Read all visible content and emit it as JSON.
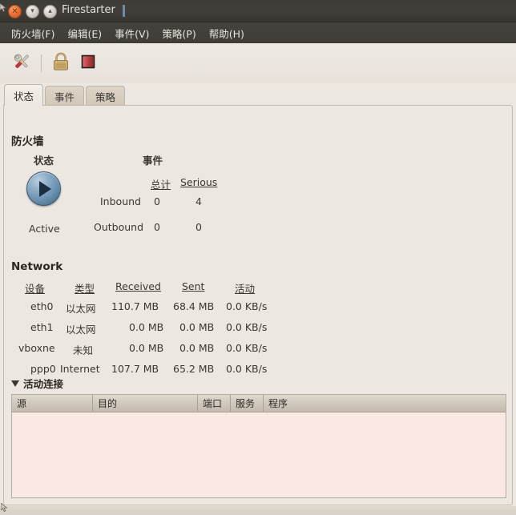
{
  "window": {
    "title": "Firestarter",
    "controls": [
      {
        "name": "close",
        "icon": "close-icon",
        "glyph": "✕"
      },
      {
        "name": "minimize",
        "icon": "minimize-icon",
        "glyph": "▾"
      },
      {
        "name": "maximize",
        "icon": "maximize-icon",
        "glyph": "▴"
      }
    ]
  },
  "menubar": {
    "items": [
      {
        "label": "防火墙(F)"
      },
      {
        "label": "编辑(E)"
      },
      {
        "label": "事件(V)"
      },
      {
        "label": "策略(P)"
      },
      {
        "label": "帮助(H)"
      }
    ]
  },
  "toolbar": {
    "buttons": [
      {
        "icon": "preferences-tools-icon",
        "tooltip": "首选项"
      },
      {
        "icon": "lock-icon",
        "tooltip": "锁定防火墙"
      },
      {
        "icon": "stop-square-icon",
        "tooltip": "停止防火墙"
      }
    ]
  },
  "tabs": [
    {
      "label": "状态",
      "active": true
    },
    {
      "label": "事件",
      "active": false
    },
    {
      "label": "策略",
      "active": false
    }
  ],
  "firewall": {
    "section_title": "防火墙",
    "status_header": "状态",
    "events_header": "事件",
    "status_value": "Active",
    "status_icon": "play-circle-icon",
    "events_table": {
      "columns": [
        "",
        "总计",
        "Serious"
      ],
      "rows": [
        {
          "direction": "Inbound",
          "total": "0",
          "serious": "4"
        },
        {
          "direction": "Outbound",
          "total": "0",
          "serious": "0"
        }
      ]
    }
  },
  "network": {
    "section_title": "Network",
    "columns": [
      "设备",
      "类型",
      "Received",
      "Sent",
      "活动"
    ],
    "rows": [
      {
        "device": "eth0",
        "type": "以太网",
        "received": "110.7 MB",
        "sent": "68.4 MB",
        "activity": "0.0 KB/s"
      },
      {
        "device": "eth1",
        "type": "以太网",
        "received": "0.0 MB",
        "sent": "0.0 MB",
        "activity": "0.0 KB/s"
      },
      {
        "device": "vboxne",
        "type": "未知",
        "received": "0.0 MB",
        "sent": "0.0 MB",
        "activity": "0.0 KB/s"
      },
      {
        "device": "ppp0",
        "type": "Internet",
        "received": "107.7 MB",
        "sent": "65.2 MB",
        "activity": "0.0 KB/s"
      }
    ]
  },
  "connections": {
    "expander_label": "活动连接",
    "expanded": true,
    "columns": [
      "源",
      "目的",
      "端口",
      "服务",
      "程序"
    ],
    "rows": []
  },
  "colors": {
    "window_bg": "#ece7e1",
    "titlebar_bg": "#403d38",
    "tab_active_bg": "#f3efe9",
    "tab_inactive_bg": "#d5cbbd",
    "treeview_bg": "#fae8e3",
    "treeview_header_bg": "#cfc7bb",
    "status_orb": "#6d93b2",
    "stop_icon": "#b5393c",
    "lock_icon": "#b08a4e"
  }
}
